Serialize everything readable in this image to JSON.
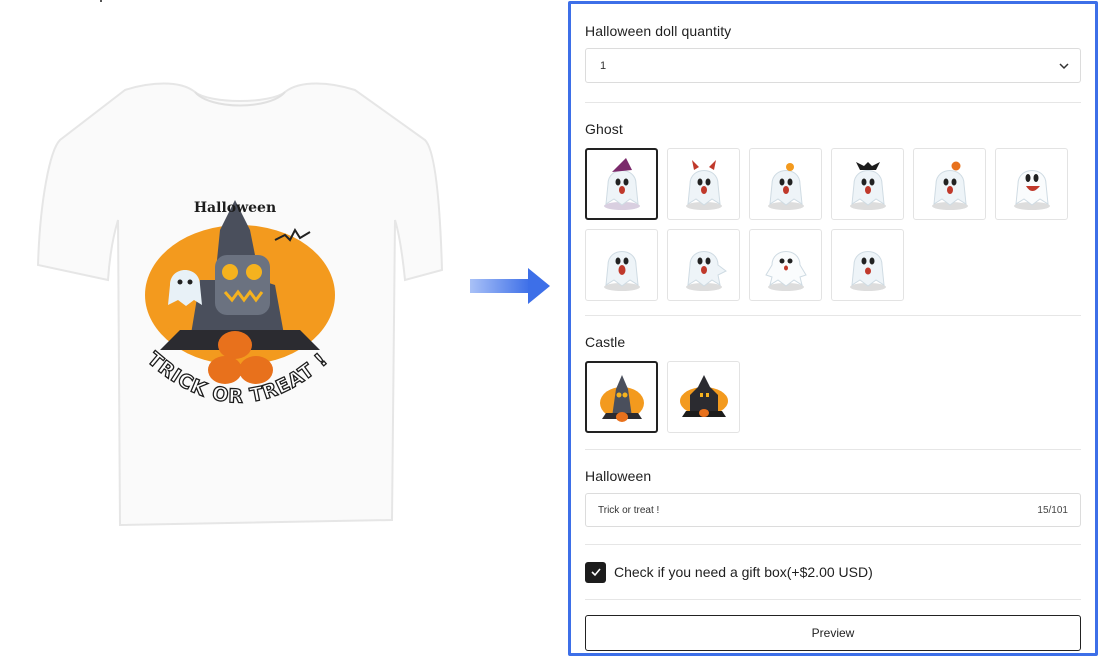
{
  "product_preview": {
    "design_top_text": "Halloween",
    "design_bottom_text": "TRICK OR TREAT !"
  },
  "options": {
    "quantity": {
      "label": "Halloween doll quantity",
      "selected": "1"
    },
    "ghost": {
      "label": "Ghost",
      "count": 10,
      "selected_index": 0
    },
    "castle": {
      "label": "Castle",
      "count": 2,
      "selected_index": 0
    },
    "text_field": {
      "label": "Halloween",
      "value": "Trick or treat !",
      "counter": "15/101"
    },
    "gift_box": {
      "label": "Check if you need a gift box(+$2.00 USD)",
      "checked": true
    },
    "preview_button": "Preview"
  },
  "colors": {
    "accent_border": "#3d6fe8",
    "arrow": "#4a7cf0",
    "pumpkin": "#f39a1e"
  }
}
